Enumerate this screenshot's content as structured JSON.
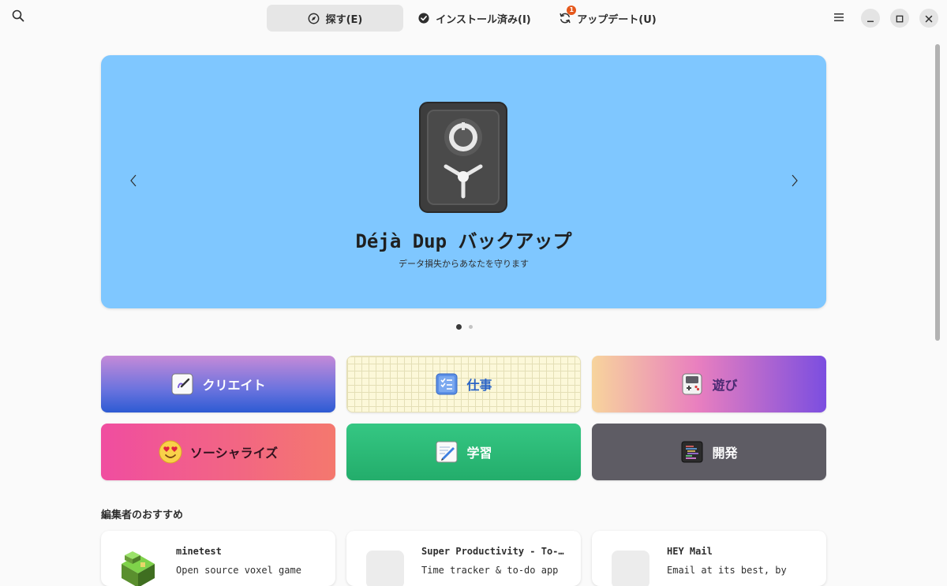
{
  "header": {
    "search_icon": "search-icon",
    "tabs": [
      {
        "label": "探す(E)",
        "icon": "compass-icon",
        "active": true
      },
      {
        "label": "インストール済み(I)",
        "icon": "check-circle-icon",
        "active": false
      },
      {
        "label": "アップデート(U)",
        "icon": "refresh-icon",
        "badge": "1",
        "active": false
      }
    ],
    "menu_icon": "hamburger-menu-icon",
    "window_controls": [
      "minimize",
      "maximize",
      "close"
    ]
  },
  "featured": {
    "app_name": "Déjà Dup バックアップ",
    "summary": "データ損失からあなたを守ります",
    "background_color": "#7fc7ff",
    "slide_count": 2,
    "active_slide": 1
  },
  "categories": [
    {
      "label": "クリエイト",
      "icon": "create-icon"
    },
    {
      "label": "仕事",
      "icon": "checklist-icon"
    },
    {
      "label": "遊び",
      "icon": "game-controller-icon"
    },
    {
      "label": "ソーシャライズ",
      "icon": "heart-eyes-emoji-icon"
    },
    {
      "label": "学習",
      "icon": "pencil-notebook-icon"
    },
    {
      "label": "開発",
      "icon": "code-editor-icon"
    }
  ],
  "editors_picks": {
    "title": "編集者のおすすめ",
    "apps": [
      {
        "name": "minetest",
        "summary": "Open source voxel game"
      },
      {
        "name": "Super Productivity - To-Do List & Time Tracker",
        "summary": "Time tracker & to-do app"
      },
      {
        "name": "HEY Mail",
        "summary": "Email at its best, by"
      }
    ]
  },
  "colors": {
    "accent_badge": "#e5581c",
    "window_bg": "#fafafa"
  }
}
